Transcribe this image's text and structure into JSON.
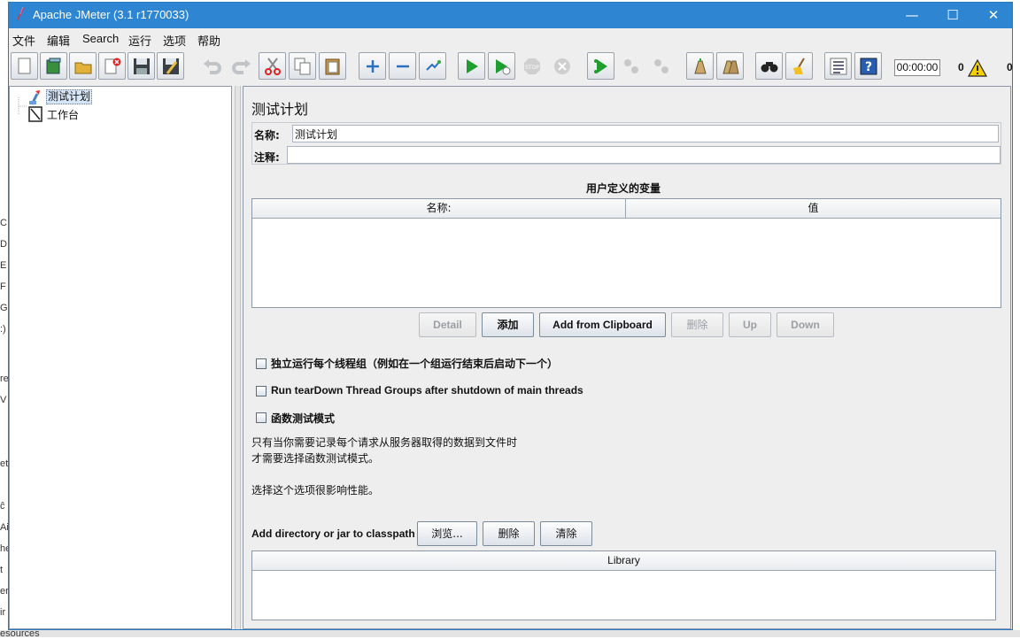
{
  "window": {
    "title": "Apache JMeter (3.1 r1770033)",
    "minimize": "—",
    "maximize": "☐",
    "close": "✕"
  },
  "menu": [
    "文件",
    "编辑",
    "Search",
    "运行",
    "选项",
    "帮助"
  ],
  "toolbar": {
    "buttons": [
      "new-icon",
      "templates-icon",
      "open-icon",
      "close-icon",
      "save-icon",
      "save-as-icon",
      "undo-icon",
      "redo-icon",
      "cut-icon",
      "copy-icon",
      "paste-icon",
      "expand-icon",
      "collapse-icon",
      "toggle-icon",
      "start-icon",
      "start-no-pause-icon",
      "stop-icon",
      "shutdown-icon",
      "remote-start-icon",
      "remote-stop-icon",
      "remote-shutdown-icon",
      "clear-icon",
      "clear-all-icon",
      "search-icon",
      "reset-search-icon",
      "function-helper-icon",
      "help-icon"
    ],
    "timer": "00:00:00",
    "error_count": "0",
    "thread_count": "0"
  },
  "tree": {
    "items": [
      "测试计划",
      "工作台"
    ]
  },
  "testplan": {
    "header": "测试计划",
    "name_label": "名称:",
    "name_value": "测试计划",
    "comment_label": "注释:",
    "comment_value": "",
    "vars_title": "用户定义的变量",
    "col_name": "名称:",
    "col_value": "值",
    "buttons": {
      "detail": "Detail",
      "add": "添加",
      "add_clipboard": "Add from Clipboard",
      "delete": "删除",
      "up": "Up",
      "down": "Down"
    },
    "opt_serialize": "独立运行每个线程组（例如在一个组运行结束后启动下一个）",
    "opt_teardown": "Run tearDown Thread Groups after shutdown of main threads",
    "opt_functional": "函数测试模式",
    "desc1": "只有当你需要记录每个请求从服务器取得的数据到文件时",
    "desc2": "才需要选择函数测试模式。",
    "desc3": "选择这个选项很影响性能。",
    "classpath_label": "Add directory or jar to classpath",
    "browse": "浏览...",
    "cp_delete": "删除",
    "cp_clear": "清除",
    "library_col": "Library"
  },
  "background": {
    "side_chars": [
      "C",
      "D",
      "E",
      "F",
      "G",
      ":)",
      "re",
      "V",
      "et",
      "ĉ",
      "Ai",
      "he",
      "t",
      "er",
      "ir"
    ],
    "bottom": "esources"
  },
  "colors": {
    "titlebar": "#2e86d2",
    "accent": "#2b78c2"
  }
}
